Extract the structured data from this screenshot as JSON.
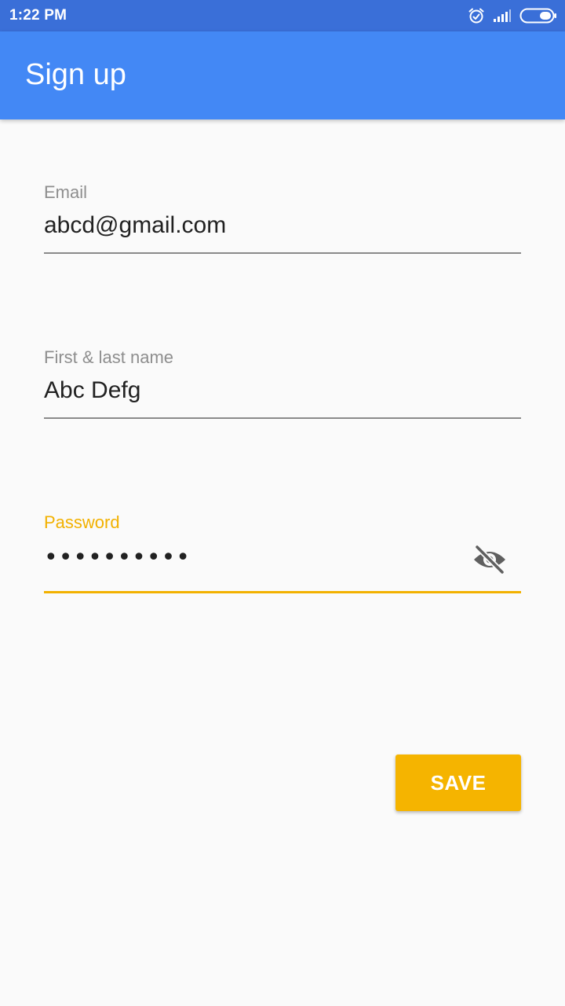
{
  "status_bar": {
    "time": "1:22 PM",
    "icons": [
      "alarm-icon",
      "signal-icon",
      "battery-icon"
    ]
  },
  "app_bar": {
    "title": "Sign up"
  },
  "form": {
    "email": {
      "label": "Email",
      "value": "abcd@gmail.com"
    },
    "name": {
      "label": "First & last name",
      "value": "Abc Defg"
    },
    "password": {
      "label": "Password",
      "masked_value": "••••••••••",
      "visibility_icon": "eye-off-icon",
      "focused": true
    }
  },
  "actions": {
    "save_label": "SAVE"
  },
  "colors": {
    "status_bar": "#3a6fd8",
    "app_bar": "#4388f5",
    "accent": "#f5b400",
    "background": "#fafafa"
  }
}
